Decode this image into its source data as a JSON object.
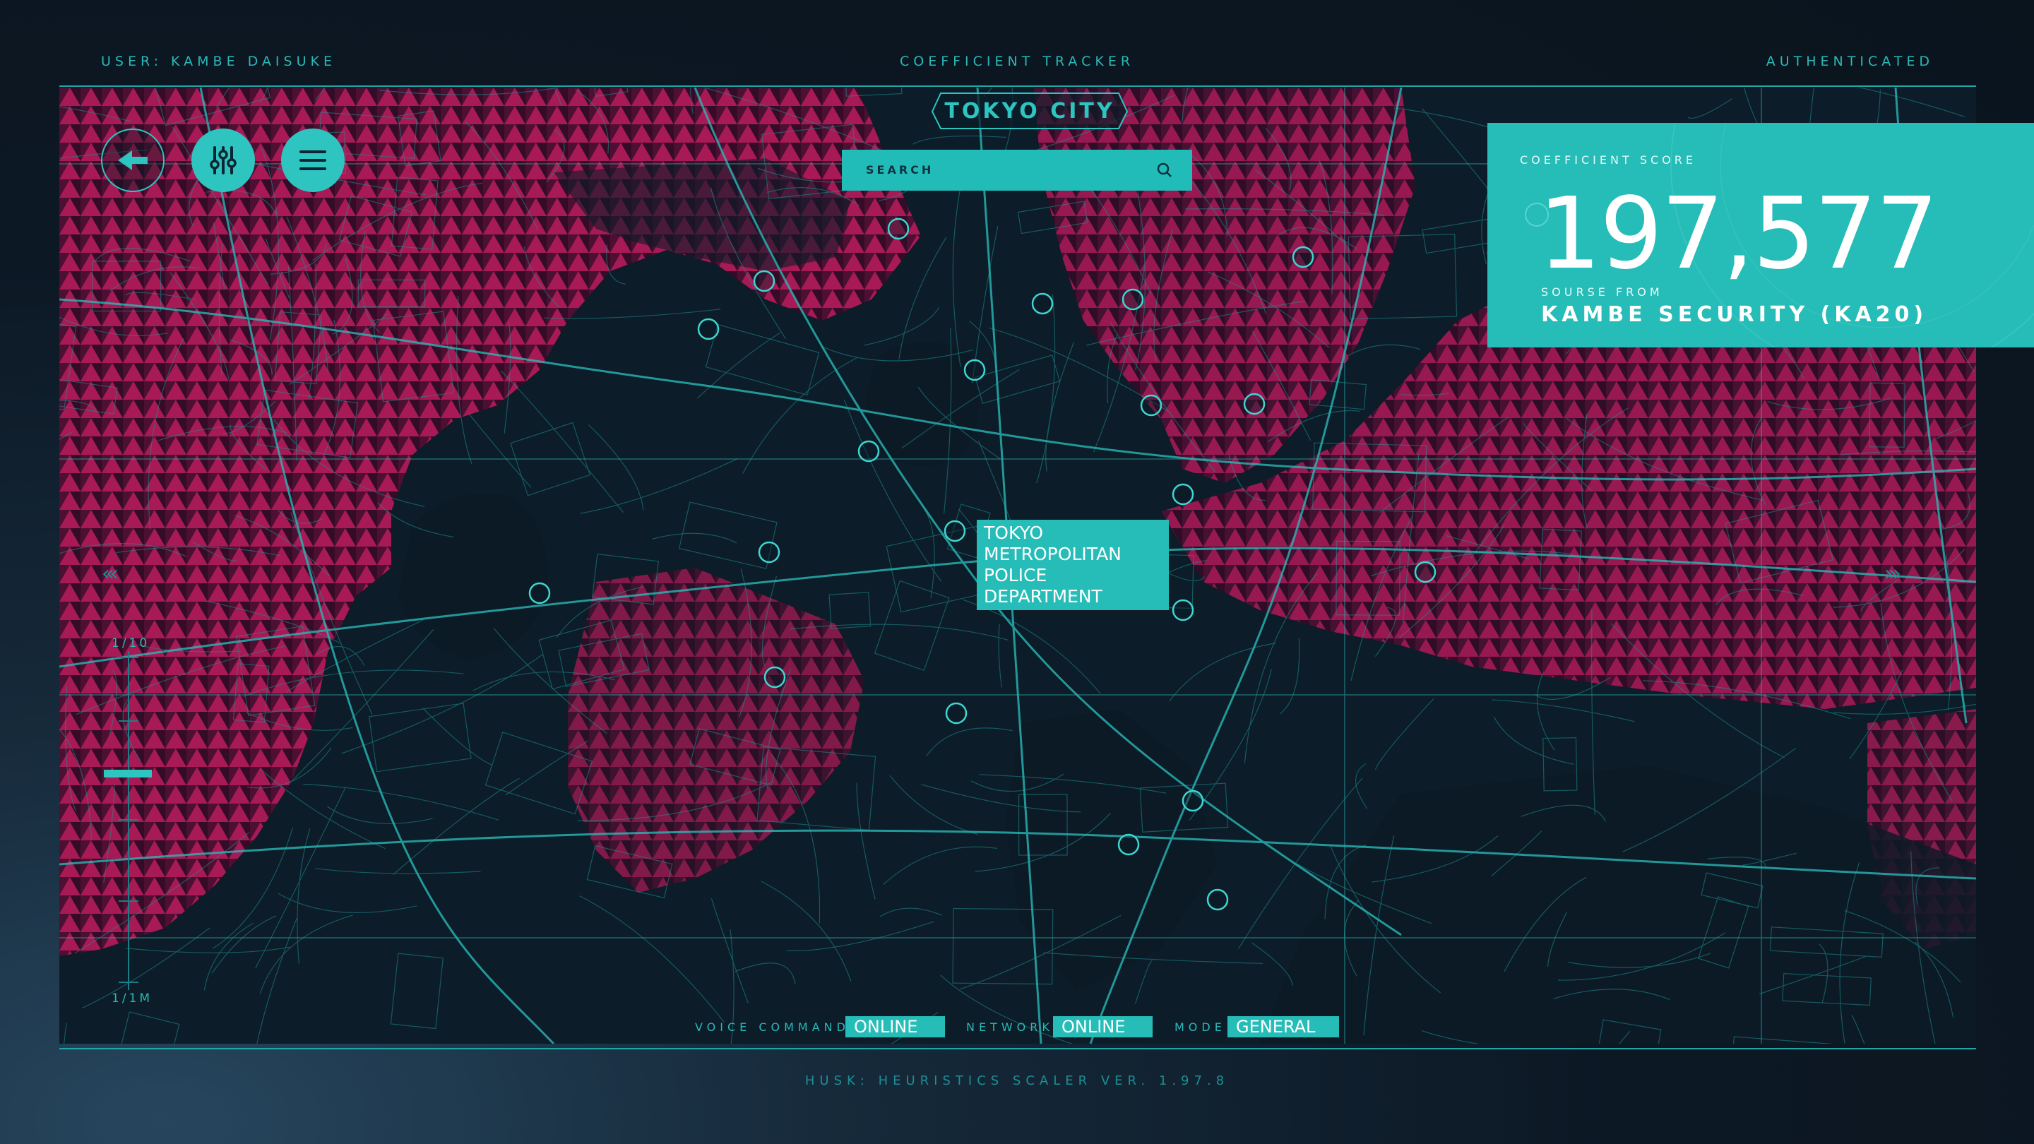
{
  "header": {
    "user": "USER: KAMBE DAISUKE",
    "title": "COEFFICIENT TRACKER",
    "status": "AUTHENTICATED"
  },
  "map": {
    "city": "TOKYO CITY",
    "search_placeholder": "SEARCH",
    "landmark_label_line1": "TOKYO METROPOLITAN",
    "landmark_label_line2": "POLICE DEPARTMENT",
    "markers_count_visible": 24
  },
  "toolbar": {
    "back_icon": "arrow-left-icon",
    "filter_icon": "sliders-icon",
    "menu_icon": "hamburger-menu-icon"
  },
  "score_card": {
    "label": "COEFFICIENT SCORE",
    "value": "197,577",
    "source_label": "SOURSE FROM",
    "source_value": "KAMBE SECURITY (KA20)"
  },
  "zoom": {
    "top_label": "1/10",
    "bottom_label": "1/1M",
    "level": 0.36
  },
  "status_bar": {
    "voice_label": "VOICE COMMAND",
    "voice_value": "ONLINE",
    "network_label": "NETWORK",
    "network_value": "ONLINE",
    "mode_label": "MODE",
    "mode_value": "GENERAL"
  },
  "footer": "HUSK: HEURISTICS SCALER VER. 1.97.8",
  "colors": {
    "accent": "#26bcb7",
    "hazard": "#c2185b",
    "background": "#0c1824"
  }
}
